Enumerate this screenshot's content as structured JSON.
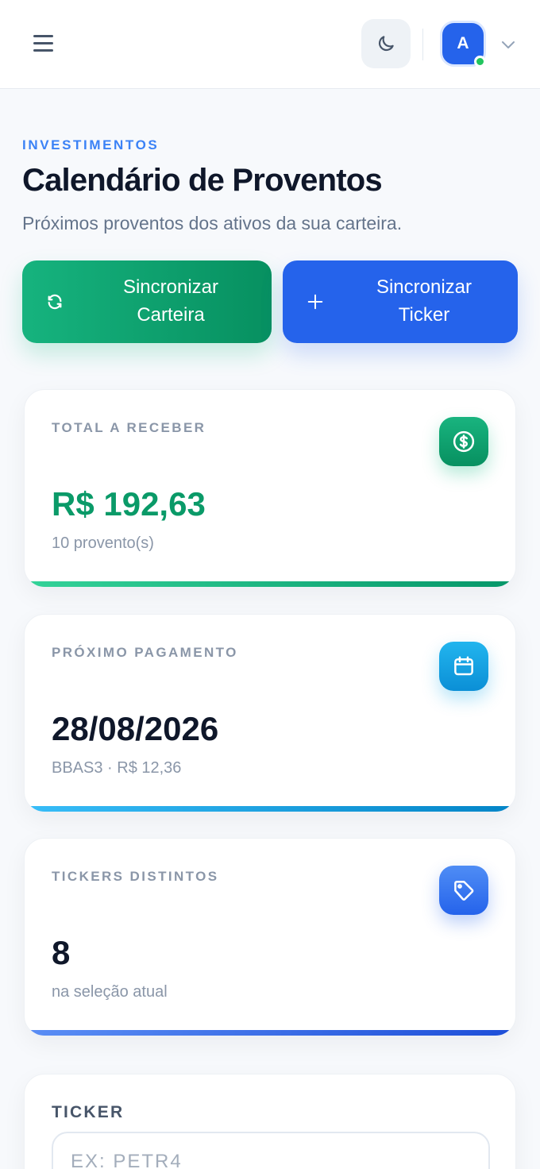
{
  "header": {
    "menu_icon": "hamburger-menu-icon",
    "theme_icon": "moon-icon",
    "avatar_initial": "A",
    "status": "online",
    "dropdown_icon": "chevron-down-icon"
  },
  "page": {
    "eyebrow": "INVESTIMENTOS",
    "title": "Calendário de Proventos",
    "subtitle": "Próximos proventos dos ativos da sua carteira."
  },
  "actions": {
    "sync_portfolio": {
      "line1": "Sincronizar",
      "line2": "Carteira",
      "icon": "refresh-icon"
    },
    "sync_ticker": {
      "line1": "Sincronizar",
      "line2": "Ticker",
      "icon": "plus-icon"
    }
  },
  "stats": {
    "total": {
      "label": "TOTAL A RECEBER",
      "value": "R$ 192,63",
      "sub": "10 provento(s)",
      "icon": "dollar-circle-icon",
      "color": "#0a9a68"
    },
    "next": {
      "label": "PRÓXIMO PAGAMENTO",
      "value": "28/08/2026",
      "sub": "BBAS3 · R$ 12,36",
      "icon": "calendar-icon",
      "color": "#0f172a"
    },
    "tickers": {
      "label": "TICKERS DISTINTOS",
      "value": "8",
      "sub": "na seleção atual",
      "icon": "tag-icon",
      "color": "#0f172a"
    }
  },
  "filter": {
    "label": "TICKER",
    "placeholder": "EX: PETR4"
  },
  "colors": {
    "accent": "#2563eb",
    "green": "#10b981",
    "sky": "#0ea5e9",
    "status_online": "#22c55e"
  }
}
